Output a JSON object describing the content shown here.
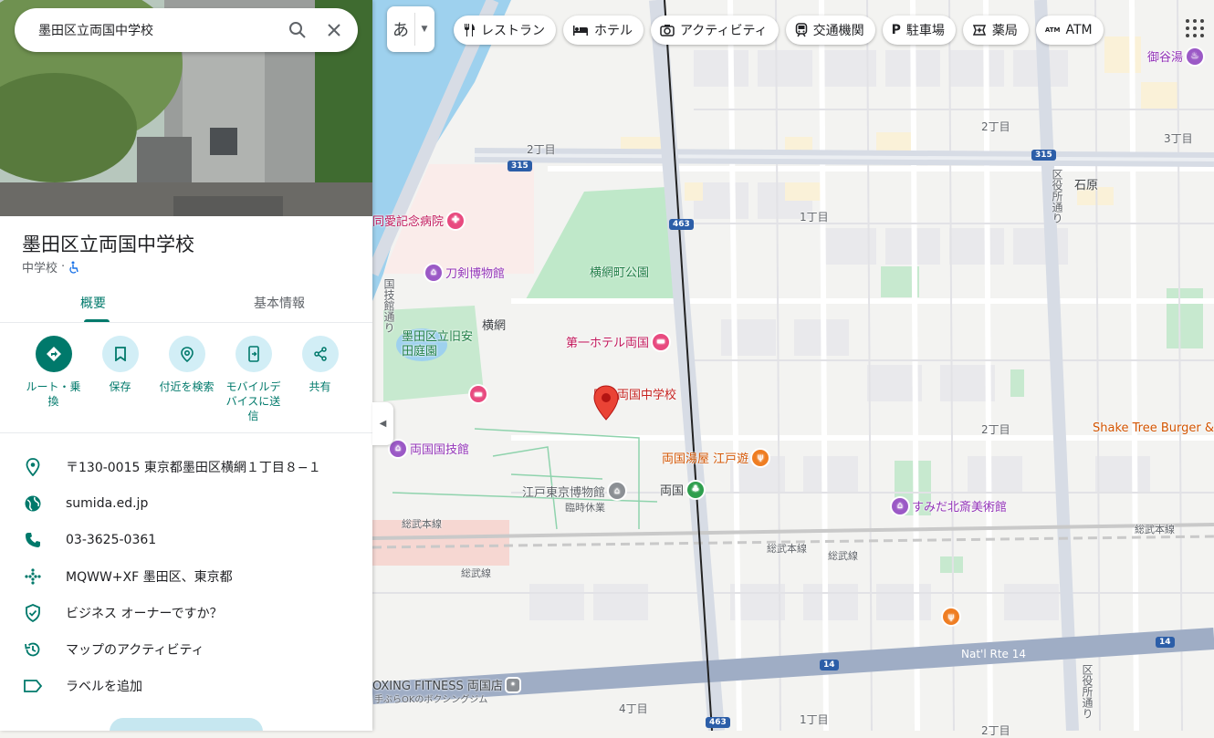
{
  "search": {
    "value": "墨田区立両国中学校"
  },
  "place": {
    "name": "墨田区立両国中学校",
    "category": "中学校",
    "separator": "·"
  },
  "tabs": [
    {
      "label": "概要"
    },
    {
      "label": "基本情報"
    }
  ],
  "actions": [
    {
      "label": "ルート・乗換",
      "icon": "directions-icon"
    },
    {
      "label": "保存",
      "icon": "bookmark-icon"
    },
    {
      "label": "付近を検索",
      "icon": "nearby-icon"
    },
    {
      "label": "モバイルデバイスに送信",
      "icon": "send-to-phone-icon"
    },
    {
      "label": "共有",
      "icon": "share-icon"
    }
  ],
  "info": [
    {
      "text": "〒130-0015 東京都墨田区横網１丁目８−１",
      "icon": "location-pin-icon"
    },
    {
      "text": "sumida.ed.jp",
      "icon": "globe-icon"
    },
    {
      "text": "03-3625-0361",
      "icon": "phone-icon"
    },
    {
      "text": "MQWW+XF 墨田区、東京都",
      "icon": "plus-code-icon"
    },
    {
      "text": "ビジネス オーナーですか？",
      "icon": "verified-shield-icon"
    },
    {
      "text": "マップのアクティビティ",
      "icon": "history-icon"
    },
    {
      "text": "ラベルを追加",
      "icon": "label-icon"
    }
  ],
  "ime": {
    "char": "あ"
  },
  "chips": [
    {
      "label": "レストラン",
      "icon": "fork-knife-icon"
    },
    {
      "label": "ホテル",
      "icon": "bed-icon"
    },
    {
      "label": "アクティビティ",
      "icon": "camera-icon"
    },
    {
      "label": "交通機関",
      "icon": "train-icon"
    },
    {
      "label": "駐車場",
      "icon": "parking-icon"
    },
    {
      "label": "薬局",
      "icon": "pharmacy-icon"
    },
    {
      "label": "ATM",
      "icon": "atm-icon"
    }
  ],
  "map": {
    "labels": {
      "chome2_a": "2丁目",
      "chome2_b": "2丁目",
      "chome3": "3丁目",
      "chome1_a": "1丁目",
      "chome2_c": "2丁目",
      "chome4": "4丁目",
      "chome1_b": "1丁目",
      "chome2_d": "2丁目",
      "ishiwara": "石原",
      "yokoami": "横網",
      "kuyakusho1": "区役所通り",
      "kuyakusho2": "区役所通り",
      "kokugikan_dori": "国技館通り",
      "sobu1": "総武本線",
      "sobu2": "総武本線",
      "sobu3": "総武線",
      "sobu4": "総武線",
      "sobu5": "総武本線",
      "natl14": "Nat'l Rte 14",
      "boxing_sub": "手ぶらOKのボクシングジム",
      "yasuda": "墨田区立旧安田庭園",
      "yokoami_park": "横網町公園",
      "ryogoku_station": "両国"
    },
    "shields": {
      "r315a": "315",
      "r315b": "315",
      "r463a": "463",
      "r463b": "463",
      "r14a": "14",
      "r14b": "14"
    },
    "pois": {
      "hospital": "同愛記念病院",
      "sword_museum": "刀剣博物館",
      "hotel1": "第一ホテル両国",
      "selected": "区立両国中学校",
      "kokugikan": "両国国技館",
      "yuya": "両国湯屋 江戸遊",
      "edo_museum": "江戸東京博物館",
      "edo_museum_status": "臨時休業",
      "hokusai": "すみだ北斎美術館",
      "shake": "Shake Tree Burger & E",
      "boxing": "OXING FITNESS 両国店",
      "mitaniyu": "御谷湯"
    }
  }
}
